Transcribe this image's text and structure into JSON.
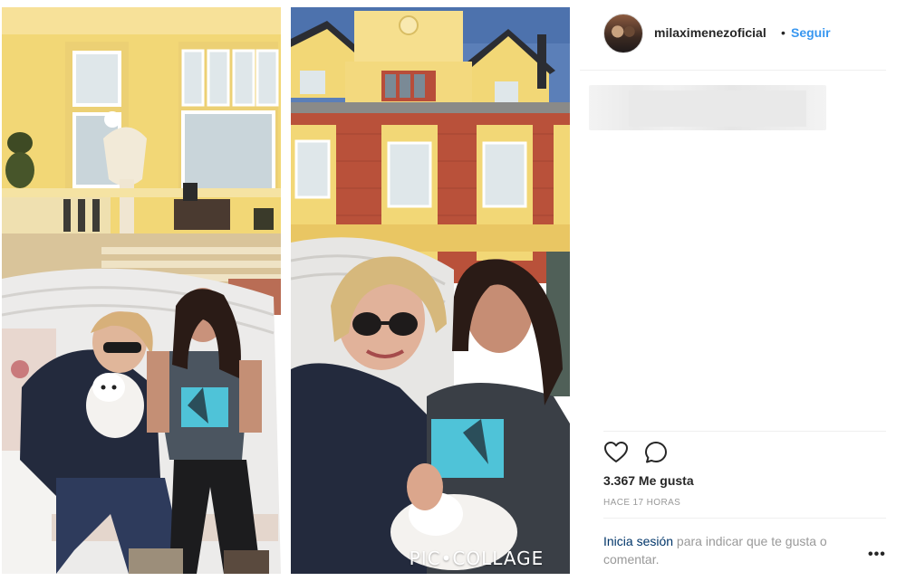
{
  "post": {
    "username": "milaximenezoficial",
    "separator": "•",
    "follow_label": "Seguir",
    "likes_text": "3.367 Me gusta",
    "timestamp": "HACE 17 HORAS",
    "login_link": "Inicia sesión",
    "login_rest": " para indicar que te gusta o comentar.",
    "more_label": "•••"
  },
  "media": {
    "watermark": "PIC•COLLAGE",
    "palette": {
      "facade_yellow": "#f2d776",
      "brick_red": "#b9513a",
      "sky_blue": "#5b7fb8",
      "wicker_white": "#ecebea",
      "navy_sweater": "#232a3d"
    }
  },
  "icons": {
    "like": "heart-outline-icon",
    "comment": "comment-bubble-icon",
    "more": "ellipsis-icon"
  }
}
